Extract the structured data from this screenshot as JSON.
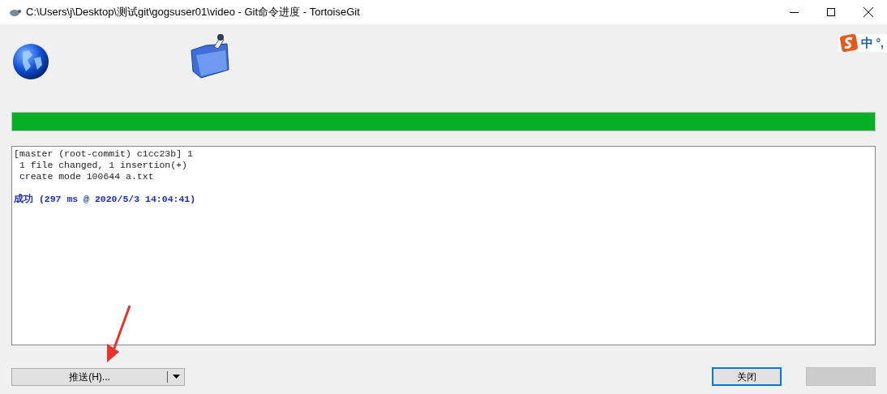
{
  "window": {
    "title": "C:\\Users\\j\\Desktop\\测试git\\gogsuser01\\video - Git命令进度 - TortoiseGit"
  },
  "ime_bar": {
    "mode": "中",
    "punctuation": "°,"
  },
  "progress": {
    "level": 1
  },
  "log": [
    {
      "kind": "normal",
      "text": "[master (root-commit) c1cc23b] 1"
    },
    {
      "kind": "normal",
      "text": " 1 file changed, 1 insertion(+)"
    },
    {
      "kind": "normal",
      "text": " create mode 100644 a.txt"
    },
    {
      "kind": "blank"
    },
    {
      "kind": "success",
      "text": "成功 (297 ms @ 2020/5/3 14:04:41)"
    }
  ],
  "buttons": {
    "push": {
      "label": "推送(H)..."
    },
    "close": {
      "label": "关闭",
      "selected": true
    },
    "extra": {
      "disabled": true
    }
  }
}
